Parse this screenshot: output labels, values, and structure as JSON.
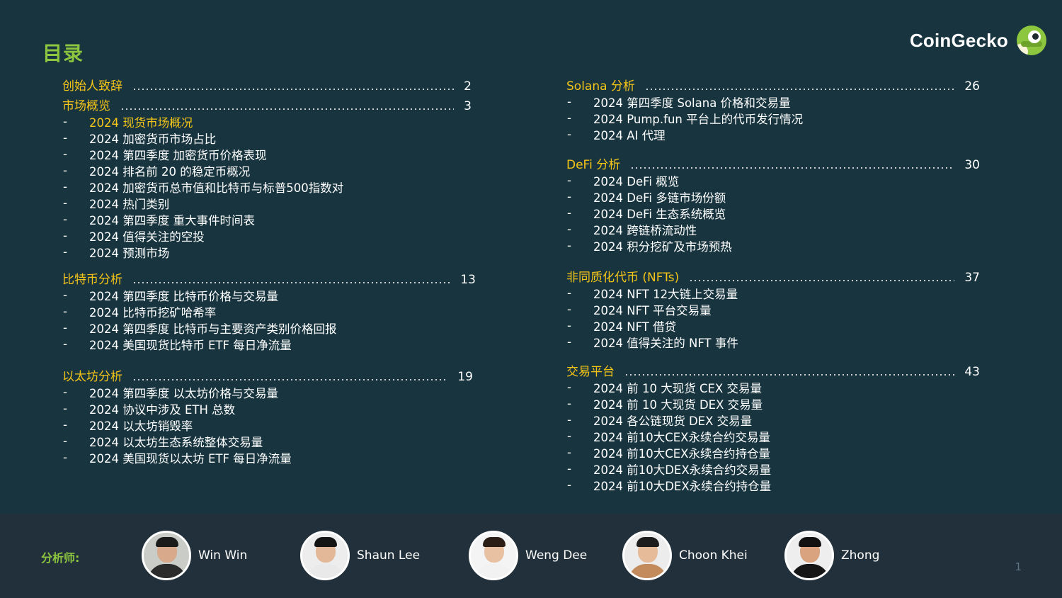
{
  "header": {
    "title": "目录",
    "brand_name": "CoinGecko",
    "brand_logo_icon": "gecko-logo-icon"
  },
  "toc": {
    "left": [
      {
        "title": "创始人致辞",
        "page": "2",
        "items": []
      },
      {
        "title": "市场概览",
        "page": "3",
        "items": [
          "2024 现货市场概况",
          "2024 加密货币市场占比",
          "2024 第四季度 加密货币价格表现",
          "2024 排名前 20 的稳定币概况",
          "2024 加密货币总市值和比特币与标普500指数对",
          "2024 热门类别",
          "2024 第四季度 重大事件时间表",
          "2024 值得关注的空投",
          "2024 预测市场"
        ]
      },
      {
        "title": "比特币分析",
        "page": "13",
        "items": [
          "2024 第四季度 比特币价格与交易量",
          "2024 比特币挖矿哈希率",
          "2024 第四季度 比特币与主要资产类别价格回报",
          "2024 美国现货比特币 ETF 每日净流量"
        ]
      },
      {
        "title": "以太坊分析",
        "page": "19",
        "items": [
          "2024 第四季度 以太坊价格与交易量",
          "2024 协议中涉及 ETH 总数",
          "2024 以太坊销毁率",
          "2024 以太坊生态系统整体交易量",
          "2024 美国现货以太坊 ETF 每日净流量"
        ]
      }
    ],
    "right": [
      {
        "title": "Solana 分析",
        "page": "26",
        "items": [
          "2024 第四季度 Solana 价格和交易量",
          "2024 Pump.fun 平台上的代币发行情况",
          "2024 AI 代理"
        ]
      },
      {
        "title": "DeFi 分析",
        "page": "30",
        "items": [
          "2024 DeFi 概览",
          "2024 DeFi 多链市场份额",
          "2024 DeFi 生态系统概览",
          "2024 跨链桥流动性",
          "2024 积分挖矿及市场预热"
        ]
      },
      {
        "title": "非同质化代币 (NFTs)",
        "page": "37",
        "items": [
          "2024 NFT 12大链上交易量",
          "2024 NFT 平台交易量",
          "2024 NFT 借贷",
          "2024 值得关注的 NFT 事件"
        ]
      },
      {
        "title": "交易平台",
        "page": "43",
        "items": [
          "2024 前 10 大现货 CEX 交易量",
          "2024 前 10 大现货 DEX 交易量",
          "2024 各公链现货 DEX 交易量",
          "2024 前10大CEX永续合约交易量",
          "2024 前10大CEX永续合约持仓量",
          "2024 前10大DEX永续合约交易量",
          "2024 前10大DEX永续合约持仓量"
        ]
      }
    ],
    "dash": "-"
  },
  "footer": {
    "analysts_label": "分析师:",
    "analysts": [
      {
        "name": "Win Win"
      },
      {
        "name": "Shaun Lee"
      },
      {
        "name": "Weng Dee"
      },
      {
        "name": "Choon Khei"
      },
      {
        "name": "Zhong"
      }
    ],
    "page_number": "1"
  },
  "colors": {
    "background": "#17343f",
    "footer_background": "#21303a",
    "title_green": "#8dc63f",
    "section_yellow": "#f5c518",
    "text_white": "#ffffff"
  }
}
